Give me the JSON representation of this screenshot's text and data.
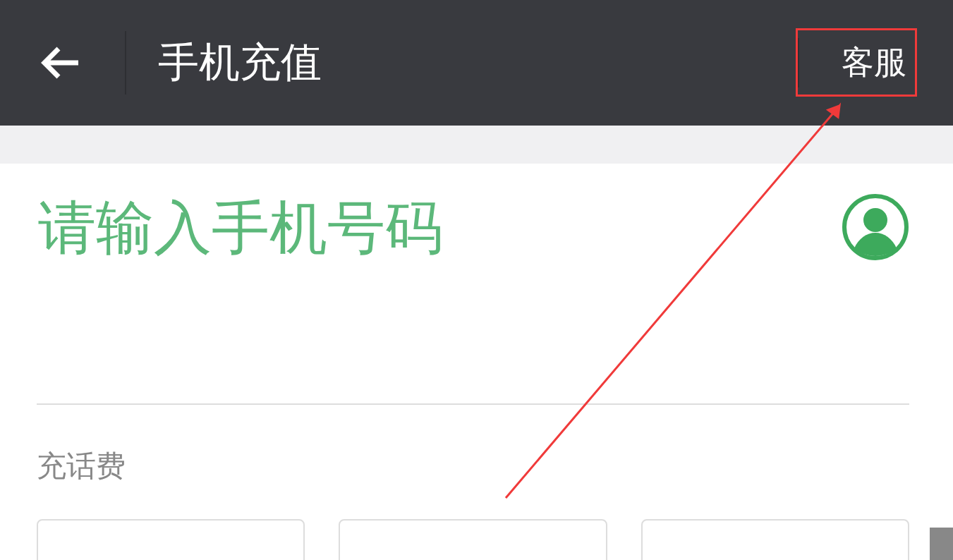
{
  "header": {
    "title": "手机充值",
    "service_button": "客服"
  },
  "phone_input": {
    "placeholder": "请输入手机号码"
  },
  "section_label": "充话费",
  "amount_cards": [
    {
      "selected": false
    },
    {
      "selected": false
    },
    {
      "selected": false
    }
  ],
  "annotation": {
    "highlight_box": true,
    "arrow": true
  }
}
